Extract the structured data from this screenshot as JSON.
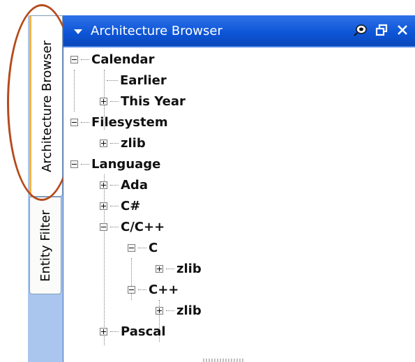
{
  "tabs": [
    {
      "label": "Architecture Browser",
      "active": true
    },
    {
      "label": "Entity Filter",
      "active": false
    }
  ],
  "panel": {
    "title": "Architecture Browser",
    "icons": [
      "pin-icon",
      "restore-icon",
      "close-icon"
    ]
  },
  "tree": [
    {
      "label": "Calendar",
      "state": "expanded"
    },
    {
      "label": "Earlier",
      "state": "leaf"
    },
    {
      "label": "This Year",
      "state": "collapsed"
    },
    {
      "label": "Filesystem",
      "state": "expanded"
    },
    {
      "label": "zlib",
      "state": "collapsed"
    },
    {
      "label": "Language",
      "state": "expanded"
    },
    {
      "label": "Ada",
      "state": "collapsed"
    },
    {
      "label": "C#",
      "state": "collapsed"
    },
    {
      "label": "C/C++",
      "state": "expanded"
    },
    {
      "label": "C",
      "state": "expanded"
    },
    {
      "label": "zlib",
      "state": "collapsed"
    },
    {
      "label": "C++",
      "state": "expanded"
    },
    {
      "label": "zlib",
      "state": "collapsed"
    },
    {
      "label": "Pascal",
      "state": "collapsed"
    }
  ],
  "colors": {
    "titlebar": "#0c54d6",
    "highlight": "#b64a1a",
    "active_tab_accent": "#f5b445"
  }
}
